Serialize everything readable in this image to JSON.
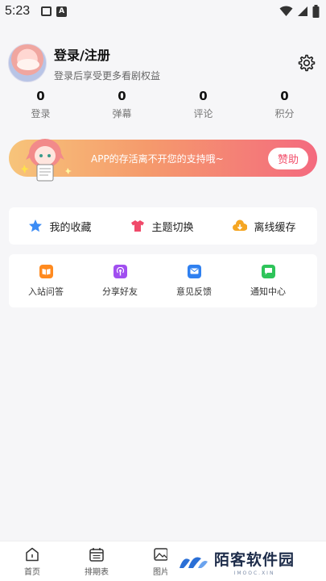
{
  "status_bar": {
    "time": "5:23"
  },
  "profile": {
    "title": "登录/注册",
    "subtitle": "登录后享受更多看剧权益"
  },
  "stats": [
    {
      "value": "0",
      "label": "登录"
    },
    {
      "value": "0",
      "label": "弹幕"
    },
    {
      "value": "0",
      "label": "评论"
    },
    {
      "value": "0",
      "label": "积分"
    }
  ],
  "banner": {
    "text": "APP的存活离不开您的支持哦~",
    "button": "赞助"
  },
  "quick_actions": [
    {
      "label": "我的收藏",
      "icon": "star-icon",
      "color": "#3b8cf5"
    },
    {
      "label": "主题切换",
      "icon": "shirt-icon",
      "color": "#f04a6a"
    },
    {
      "label": "离线缓存",
      "icon": "download-icon",
      "color": "#f5a623"
    }
  ],
  "services": [
    {
      "label": "入站问答",
      "icon": "book-icon",
      "color": "#ff8a1f"
    },
    {
      "label": "分享好友",
      "icon": "podcast-icon",
      "color": "#a14ff0"
    },
    {
      "label": "意见反馈",
      "icon": "mail-icon",
      "color": "#2f80f0"
    },
    {
      "label": "通知中心",
      "icon": "message-icon",
      "color": "#2ec45a"
    }
  ],
  "bottom_nav": [
    {
      "label": "首页",
      "icon": "home-icon"
    },
    {
      "label": "排期表",
      "icon": "calendar-icon"
    },
    {
      "label": "图片",
      "icon": "image-icon"
    }
  ],
  "watermark": {
    "main": "陌客软件园",
    "sub": "IMOOC.XIN"
  }
}
